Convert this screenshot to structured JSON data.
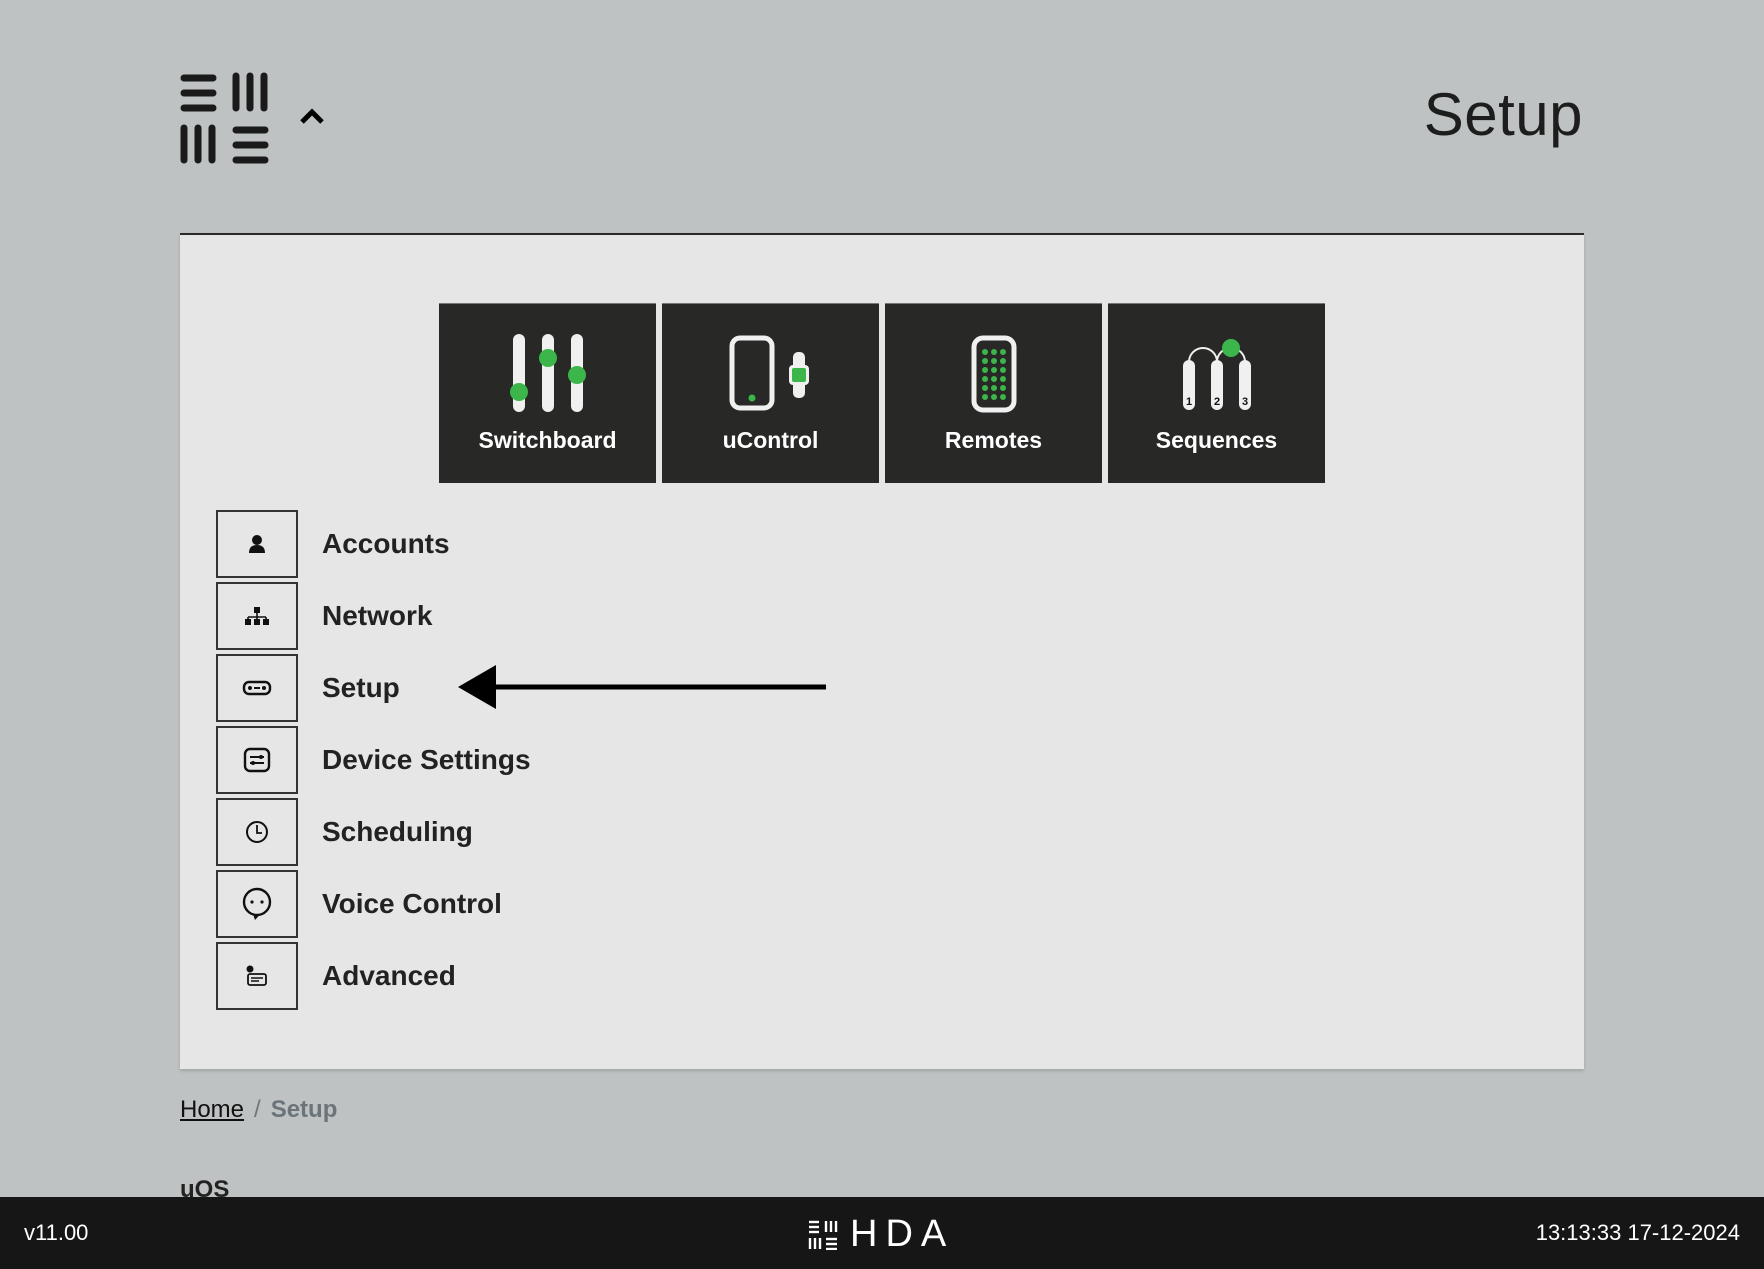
{
  "header": {
    "title": "Setup",
    "logo_icon": "hda-grid-logo",
    "collapse_icon": "chevron-up-icon"
  },
  "tiles": [
    {
      "label": "Switchboard",
      "icon": "sliders-icon"
    },
    {
      "label": "uControl",
      "icon": "phone-watch-icon"
    },
    {
      "label": "Remotes",
      "icon": "remote-icon"
    },
    {
      "label": "Sequences",
      "icon": "sequence-icon"
    }
  ],
  "menu": [
    {
      "label": "Accounts",
      "icon": "user-icon"
    },
    {
      "label": "Network",
      "icon": "network-icon"
    },
    {
      "label": "Setup",
      "icon": "setup-icon"
    },
    {
      "label": "Device Settings",
      "icon": "device-settings-icon"
    },
    {
      "label": "Scheduling",
      "icon": "clock-icon"
    },
    {
      "label": "Voice Control",
      "icon": "speech-bubble-icon"
    },
    {
      "label": "Advanced",
      "icon": "advanced-icon"
    }
  ],
  "breadcrumb": {
    "home": "Home",
    "separator": "/",
    "current": "Setup"
  },
  "section_label": "uOS",
  "footer": {
    "version": "v11.00",
    "brand": "HDA",
    "datetime": "13:13:33 17-12-2024"
  },
  "colors": {
    "accent_green": "#3cb64a",
    "tile_bg": "#282827",
    "page_bg": "#bec2c2",
    "panel_bg": "#e6e6e6",
    "footer_bg": "#161616"
  }
}
